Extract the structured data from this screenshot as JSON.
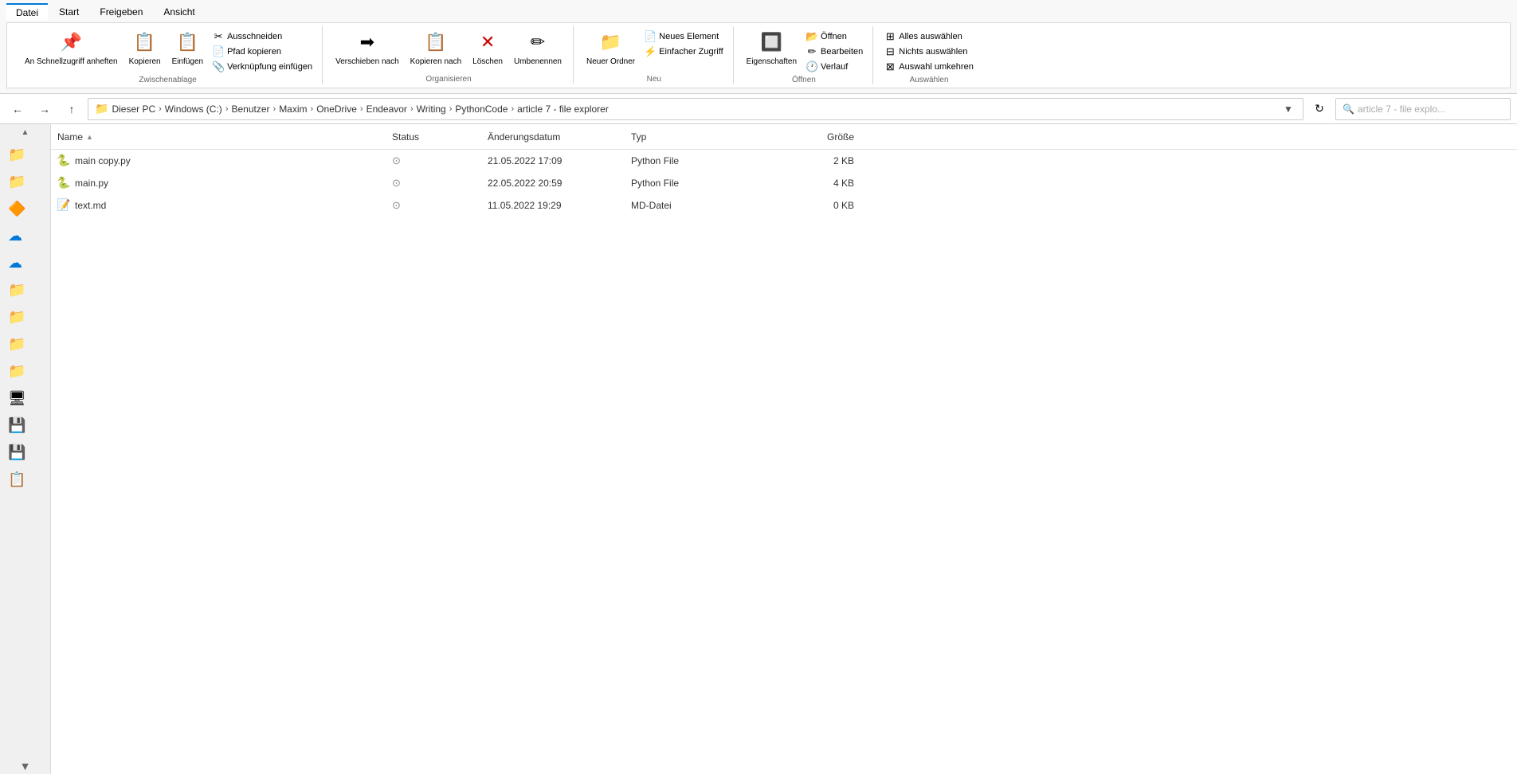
{
  "ribbon": {
    "tabs": [
      "Datei",
      "Start",
      "Freigeben",
      "Ansicht"
    ],
    "active_tab": "Start",
    "groups": {
      "clipboard": {
        "label": "Zwischenablage",
        "pin_label": "An Schnellzugriff\nanheften",
        "copy_label": "Kopieren",
        "paste_label": "Einfügen",
        "cut_label": "Ausschneiden",
        "path_copy_label": "Pfad kopieren",
        "shortcut_label": "Verknüpfung einfügen"
      },
      "organize": {
        "label": "Organisieren",
        "move_label": "Verschieben\nnach",
        "copy_label": "Kopieren\nnach",
        "delete_label": "Löschen",
        "rename_label": "Umbenennen"
      },
      "new": {
        "label": "Neu",
        "new_folder_label": "Neuer\nOrdner",
        "new_item_label": "Neues Element",
        "quick_access_label": "Einfacher Zugriff"
      },
      "open": {
        "label": "Öffnen",
        "properties_label": "Eigenschaften",
        "open_label": "Öffnen",
        "edit_label": "Bearbeiten",
        "history_label": "Verlauf"
      },
      "select": {
        "label": "Auswählen",
        "select_all_label": "Alles auswählen",
        "select_none_label": "Nichts auswählen",
        "invert_label": "Auswahl umkehren"
      }
    }
  },
  "nav": {
    "back_title": "Zurück",
    "forward_title": "Vorwärts",
    "up_title": "Nach oben",
    "breadcrumbs": [
      "Dieser PC",
      "Windows (C:)",
      "Benutzer",
      "Maxim",
      "OneDrive",
      "Endeavor",
      "Writing",
      "PythonCode",
      "article 7 - file explorer"
    ],
    "search_placeholder": "article 7 - file explo..."
  },
  "sidebar": {
    "icons": [
      "📁",
      "📁",
      "🔶",
      "☁",
      "☁",
      "📁",
      "📁",
      "📁",
      "📁",
      "🖥",
      "💾",
      "💾",
      "📋"
    ]
  },
  "file_table": {
    "columns": {
      "name": "Name",
      "status": "Status",
      "date": "Änderungsdatum",
      "type": "Typ",
      "size": "Größe"
    },
    "files": [
      {
        "name": "main copy.py",
        "icon": "py",
        "status": "synced",
        "date": "21.05.2022 17:09",
        "type": "Python File",
        "size": "2 KB"
      },
      {
        "name": "main.py",
        "icon": "py",
        "status": "synced",
        "date": "22.05.2022 20:59",
        "type": "Python File",
        "size": "4 KB"
      },
      {
        "name": "text.md",
        "icon": "md",
        "status": "synced",
        "date": "11.05.2022 19:29",
        "type": "MD-Datei",
        "size": "0 KB"
      }
    ]
  }
}
